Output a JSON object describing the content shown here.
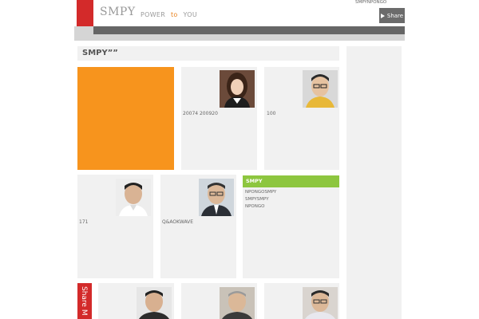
{
  "header": {
    "logo": "SMPY",
    "tagline_power": "POWER",
    "tagline_to": "to",
    "tagline_you": "YOU",
    "top_link": "SMPYNPONGO",
    "share_label": "Share"
  },
  "section": {
    "title": "SMPY””"
  },
  "cards": {
    "card2_text": "20074  200920",
    "card3_text": "100",
    "card4_text": "171",
    "card5_text": "Q&AOKWAVE"
  },
  "links_panel": {
    "title": "SMPY",
    "items": [
      "NPONGOSMPY",
      "SMPYSMPY",
      "NPONGO"
    ]
  },
  "share_vertical": "Share M",
  "colors": {
    "accent_red": "#d32a2a",
    "accent_orange": "#f7941d",
    "accent_green": "#8dc63f"
  }
}
